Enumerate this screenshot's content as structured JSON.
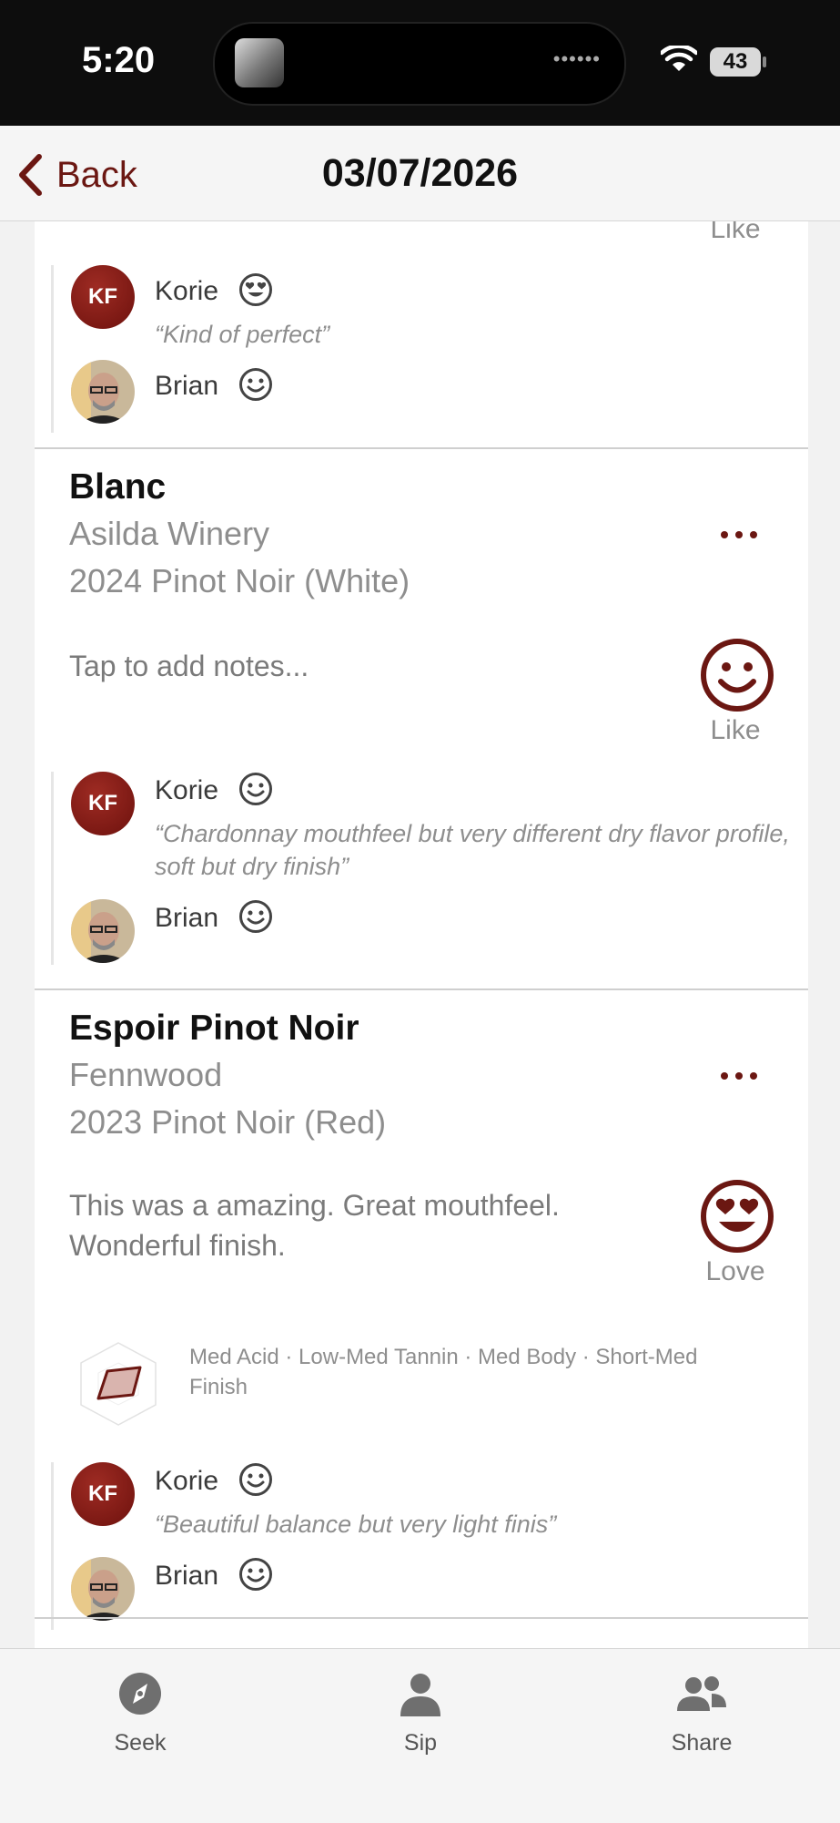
{
  "status_bar": {
    "time": "5:20",
    "battery": "43"
  },
  "nav": {
    "back_label": "Back",
    "title": "03/07/2026"
  },
  "previous_card": {
    "rating_label": "Like",
    "comments": [
      {
        "initials": "KF",
        "name": "Korie",
        "reaction": "love",
        "text": "“Kind of perfect”"
      },
      {
        "name": "Brian",
        "reaction": "like"
      }
    ]
  },
  "wines": [
    {
      "name": "Blanc",
      "winery": "Asilda Winery",
      "vintage": "2024 Pinot Noir  (White)",
      "notes_placeholder": "Tap to add notes...",
      "rating": "like",
      "rating_label": "Like",
      "comments": [
        {
          "initials": "KF",
          "name": "Korie",
          "reaction": "like",
          "text": "“Chardonnay mouthfeel but very different dry flavor profile, soft but dry finish”"
        },
        {
          "name": "Brian",
          "reaction": "like"
        }
      ]
    },
    {
      "name": "Espoir Pinot Noir",
      "winery": "Fennwood",
      "vintage": "2023 Pinot Noir  (Red)",
      "notes": "This was a amazing. Great mouthfeel. Wonderful finish.",
      "rating": "love",
      "rating_label": "Love",
      "tasting_summary": "Med Acid · Low-Med Tannin · Med Body · Short-Med Finish",
      "comments": [
        {
          "initials": "KF",
          "name": "Korie",
          "reaction": "like",
          "text": "“Beautiful balance but very light finis”"
        },
        {
          "name": "Brian",
          "reaction": "like"
        }
      ]
    }
  ],
  "tabs": [
    {
      "label": "Seek",
      "icon": "compass-icon"
    },
    {
      "label": "Sip",
      "icon": "person-icon"
    },
    {
      "label": "Share",
      "icon": "people-icon"
    }
  ],
  "colors": {
    "accent": "#6b1712",
    "avatar": "#8b1e17",
    "muted_text": "#8e8e8e"
  }
}
